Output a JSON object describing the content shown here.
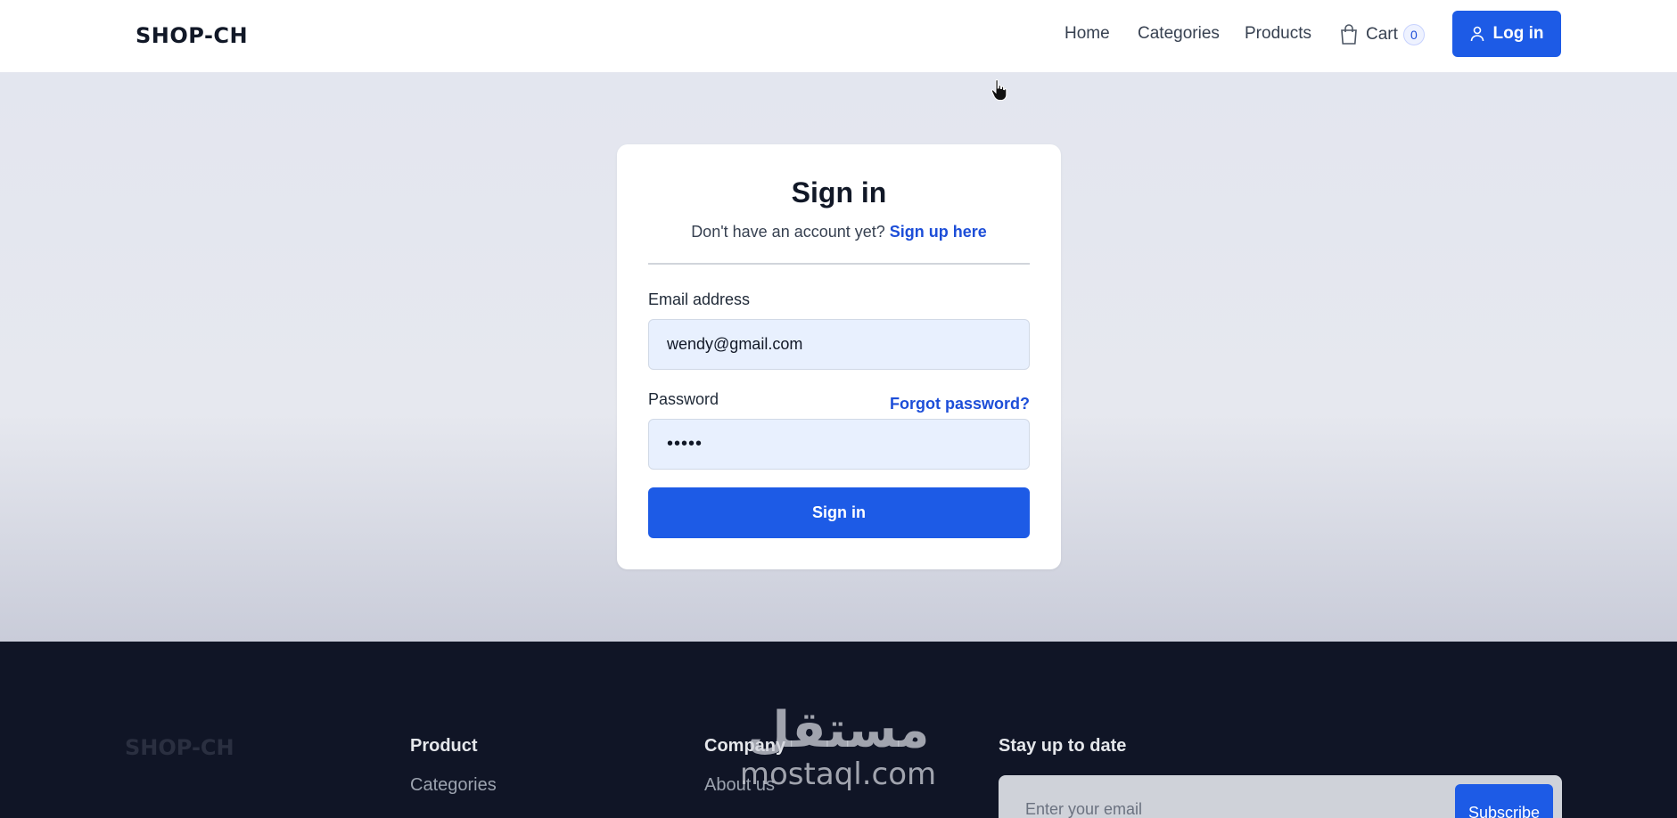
{
  "header": {
    "logo": "SHOP-CH",
    "nav": {
      "home": "Home",
      "categories": "Categories",
      "products": "Products",
      "cart_label": "Cart",
      "cart_count": "0"
    },
    "login_label": "Log in"
  },
  "signin": {
    "title": "Sign in",
    "subtitle_prefix": "Don't have an account yet?",
    "signup_link": "Sign up here",
    "email_label": "Email address",
    "email_value": "wendy@gmail.com",
    "password_label": "Password",
    "forgot_link": "Forgot password?",
    "password_value": "•••••",
    "submit_label": "Sign in"
  },
  "footer": {
    "logo": "SHOP-CH",
    "product_heading": "Product",
    "product_links": [
      "Categories"
    ],
    "company_heading": "Company",
    "company_links": [
      "About us"
    ],
    "newsletter_heading": "Stay up to date",
    "newsletter_placeholder": "Enter your email",
    "subscribe_label": "Subscribe"
  },
  "watermark": {
    "arabic": "مستقل",
    "latin": "mostaql.com"
  },
  "colors": {
    "primary": "#1d5be6",
    "link": "#1d4ed8",
    "footer_bg": "#101526",
    "input_bg": "#e8f0fe"
  },
  "icons": {
    "cart": "shopping-bag-icon",
    "user": "user-icon",
    "cursor": "hand-pointer-icon"
  }
}
